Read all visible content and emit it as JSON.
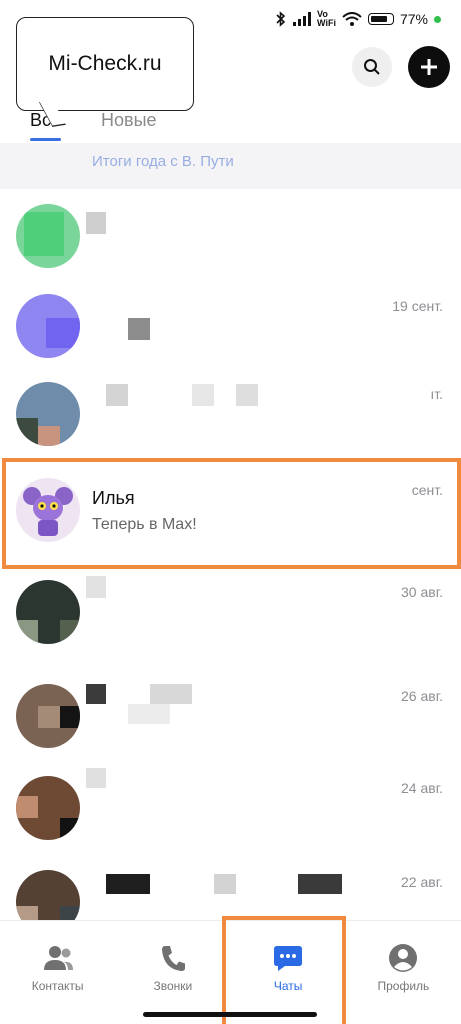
{
  "status": {
    "vo": "Vo",
    "wifi": "WiFi",
    "battery": "77%"
  },
  "watermark": "Mi-Check.ru",
  "tabs": [
    {
      "label": "Все",
      "active": true
    },
    {
      "label": "Новые",
      "active": false
    }
  ],
  "banner": {
    "text": "Итоги года с В. Пути"
  },
  "chats": [
    {
      "date": ""
    },
    {
      "date": "19 сент."
    },
    {
      "date": "ıт."
    },
    {
      "name": "Илья",
      "message": "Теперь в Max!",
      "date": " сент."
    },
    {
      "date": "30 авг."
    },
    {
      "date": "26 авг."
    },
    {
      "date": "24 авг."
    },
    {
      "date": "22 авг."
    }
  ],
  "nav": {
    "contacts": "Контакты",
    "calls": "Звонки",
    "chats": "Чаты",
    "profile": "Профиль"
  },
  "colors": {
    "accent": "#2a6be5",
    "highlight": "#ef8a3e"
  },
  "icons": [
    "bluetooth-icon",
    "signal-icon",
    "wifi-icon",
    "battery-icon",
    "search-icon",
    "plus-icon",
    "contacts-icon",
    "phone-icon",
    "chat-bubble-icon",
    "profile-icon"
  ]
}
